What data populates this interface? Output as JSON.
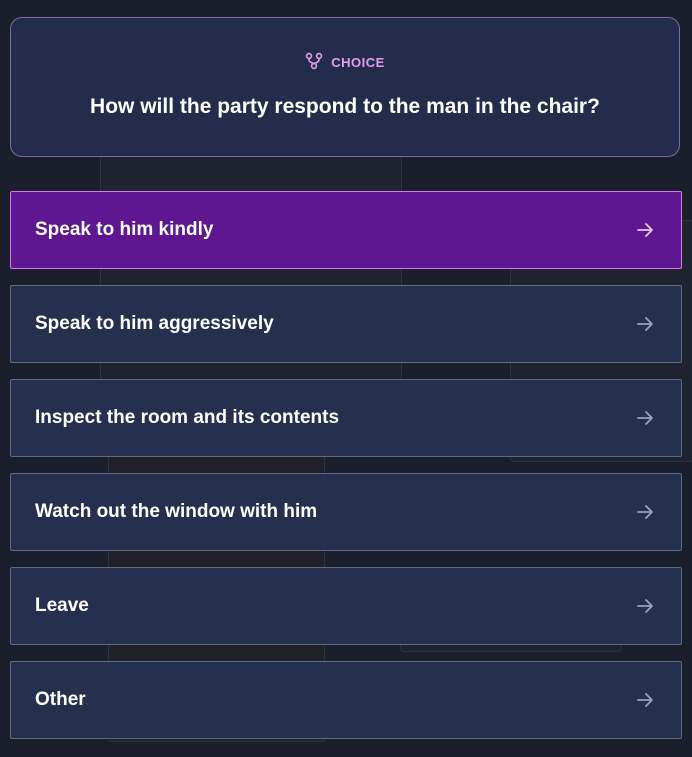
{
  "header": {
    "tag": "CHOICE",
    "title": "How will the party respond to the man in the chair?"
  },
  "options": [
    {
      "label": "Speak to him kindly",
      "selected": true
    },
    {
      "label": "Speak to him aggressively"
    },
    {
      "label": "Inspect the room and its contents"
    },
    {
      "label": "Watch out the window with him"
    },
    {
      "label": "Leave"
    },
    {
      "label": "Other"
    }
  ],
  "colors": {
    "accent": "#e79af2",
    "selected_bg": "#5e1791",
    "panel_bg": "#263252"
  },
  "icons": {
    "tag": "branch-icon",
    "option": "arrow-right-icon"
  }
}
